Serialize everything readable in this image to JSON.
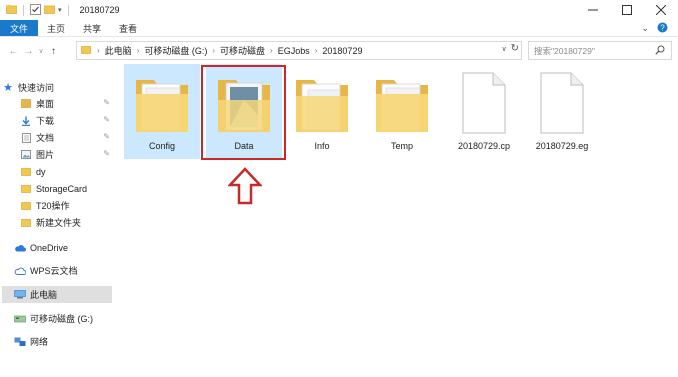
{
  "window": {
    "title": "20180729",
    "controls": [
      "minimize",
      "maximize",
      "close"
    ]
  },
  "ribbon": {
    "tabs": [
      {
        "label": "文件",
        "active": true
      },
      {
        "label": "主页",
        "active": false
      },
      {
        "label": "共享",
        "active": false
      },
      {
        "label": "查看",
        "active": false
      }
    ]
  },
  "address": {
    "crumbs": [
      "此电脑",
      "可移动磁盘 (G:)",
      "可移动磁盘",
      "EGJobs",
      "20180729"
    ],
    "search_placeholder": "搜索\"20180729\""
  },
  "nav": {
    "quick_access": "快速访问",
    "items": [
      {
        "label": "桌面",
        "pinned": true
      },
      {
        "label": "下载",
        "pinned": true
      },
      {
        "label": "文档",
        "pinned": true
      },
      {
        "label": "图片",
        "pinned": true
      },
      {
        "label": "dy",
        "pinned": false
      },
      {
        "label": "StorageCard",
        "pinned": false
      },
      {
        "label": "T20操作",
        "pinned": false
      },
      {
        "label": "新建文件夹",
        "pinned": false
      }
    ],
    "onedrive": "OneDrive",
    "wps": "WPS云文档",
    "this_pc": "此电脑",
    "removable": "可移动磁盘 (G:)",
    "network": "网络"
  },
  "files": [
    {
      "name": "Config",
      "type": "folder",
      "selected": true
    },
    {
      "name": "Data",
      "type": "folder",
      "selected": true,
      "highlighted": true
    },
    {
      "name": "Info",
      "type": "folder",
      "selected": false
    },
    {
      "name": "Temp",
      "type": "folder",
      "selected": false
    },
    {
      "name": "20180729.cp",
      "type": "file",
      "selected": false
    },
    {
      "name": "20180729.eg",
      "type": "file",
      "selected": false
    }
  ],
  "colors": {
    "accent": "#1979ca",
    "selection": "#cce8ff",
    "highlight_border": "#c82a2a",
    "folder": "#f5d378"
  }
}
